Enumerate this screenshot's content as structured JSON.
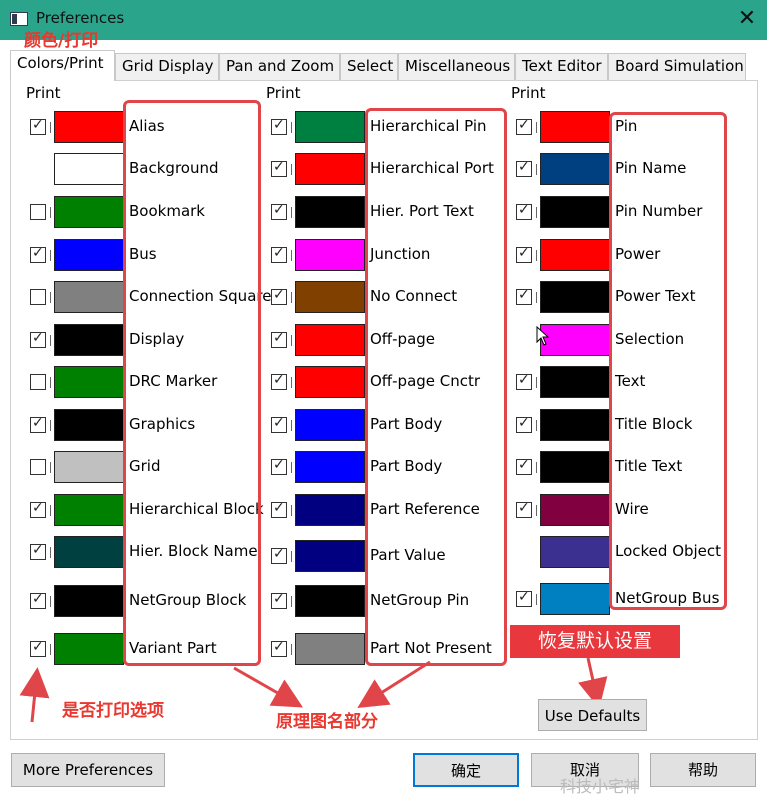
{
  "window": {
    "title": "Preferences"
  },
  "annotations": {
    "tab_note": "颜色/打印",
    "print_note": "是否打印选项",
    "names_note": "原理图名部分",
    "defaults_note": "恢复默认设置"
  },
  "tabs": [
    {
      "label": "Colors/Print",
      "active": true
    },
    {
      "label": "Grid Display"
    },
    {
      "label": "Pan and Zoom"
    },
    {
      "label": "Select"
    },
    {
      "label": "Miscellaneous"
    },
    {
      "label": "Text Editor"
    },
    {
      "label": "Board Simulation"
    }
  ],
  "print_header": "Print",
  "columns": [
    {
      "items": [
        {
          "label": "Alias",
          "color": "#ff0000",
          "print": true
        },
        {
          "label": "Background",
          "color": "#ffffff",
          "print": null
        },
        {
          "label": "Bookmark",
          "color": "#008000",
          "print": false
        },
        {
          "label": "Bus",
          "color": "#0000ff",
          "print": true
        },
        {
          "label": "Connection Square",
          "color": "#808080",
          "print": false
        },
        {
          "label": "Display",
          "color": "#000000",
          "print": true
        },
        {
          "label": "DRC Marker",
          "color": "#008000",
          "print": false
        },
        {
          "label": "Graphics",
          "color": "#000000",
          "print": true
        },
        {
          "label": "Grid",
          "color": "#c0c0c0",
          "print": false
        },
        {
          "label": "Hierarchical Block",
          "color": "#008000",
          "print": true
        },
        {
          "label": "Hier. Block Name",
          "color": "#004040",
          "print": true
        },
        {
          "label": "NetGroup Block",
          "color": "#000000",
          "print": true
        },
        {
          "label": "Variant Part",
          "color": "#008000",
          "print": true
        }
      ]
    },
    {
      "items": [
        {
          "label": "Hierarchical Pin",
          "color": "#008040",
          "print": true
        },
        {
          "label": "Hierarchical Port",
          "color": "#ff0000",
          "print": true
        },
        {
          "label": "Hier. Port Text",
          "color": "#000000",
          "print": true
        },
        {
          "label": "Junction",
          "color": "#ff00ff",
          "print": true
        },
        {
          "label": "No Connect",
          "color": "#804000",
          "print": true
        },
        {
          "label": "Off-page",
          "color": "#ff0000",
          "print": true
        },
        {
          "label": "Off-page Cnctr",
          "color": "#ff0000",
          "print": true
        },
        {
          "label": "Part Body",
          "color": "#0000ff",
          "print": true
        },
        {
          "label": "Part Body",
          "color": "#0000ff",
          "print": true
        },
        {
          "label": "Part Reference",
          "color": "#000080",
          "print": true
        },
        {
          "label": "Part Value",
          "color": "#000080",
          "print": true
        },
        {
          "label": "NetGroup Pin",
          "color": "#000000",
          "print": true
        },
        {
          "label": "Part Not Present",
          "color": "#808080",
          "print": true
        }
      ]
    },
    {
      "items": [
        {
          "label": "Pin",
          "color": "#ff0000",
          "print": true
        },
        {
          "label": "Pin Name",
          "color": "#004080",
          "print": true
        },
        {
          "label": "Pin Number",
          "color": "#000000",
          "print": true
        },
        {
          "label": "Power",
          "color": "#ff0000",
          "print": true
        },
        {
          "label": "Power Text",
          "color": "#000000",
          "print": true
        },
        {
          "label": "Selection",
          "color": "#ff00ff",
          "print": null
        },
        {
          "label": "Text",
          "color": "#000000",
          "print": true
        },
        {
          "label": "Title Block",
          "color": "#000000",
          "print": true
        },
        {
          "label": "Title Text",
          "color": "#000000",
          "print": true
        },
        {
          "label": "Wire",
          "color": "#800040",
          "print": true
        },
        {
          "label": "Locked Object",
          "color": "#3b3090",
          "print": null
        },
        {
          "label": "NetGroup Bus",
          "color": "#0080c0",
          "print": true
        }
      ]
    }
  ],
  "buttons": {
    "use_defaults": "Use Defaults",
    "more_preferences": "More Preferences",
    "ok": "确定",
    "cancel": "取消",
    "help": "帮助"
  },
  "watermark": "科技小宅神"
}
